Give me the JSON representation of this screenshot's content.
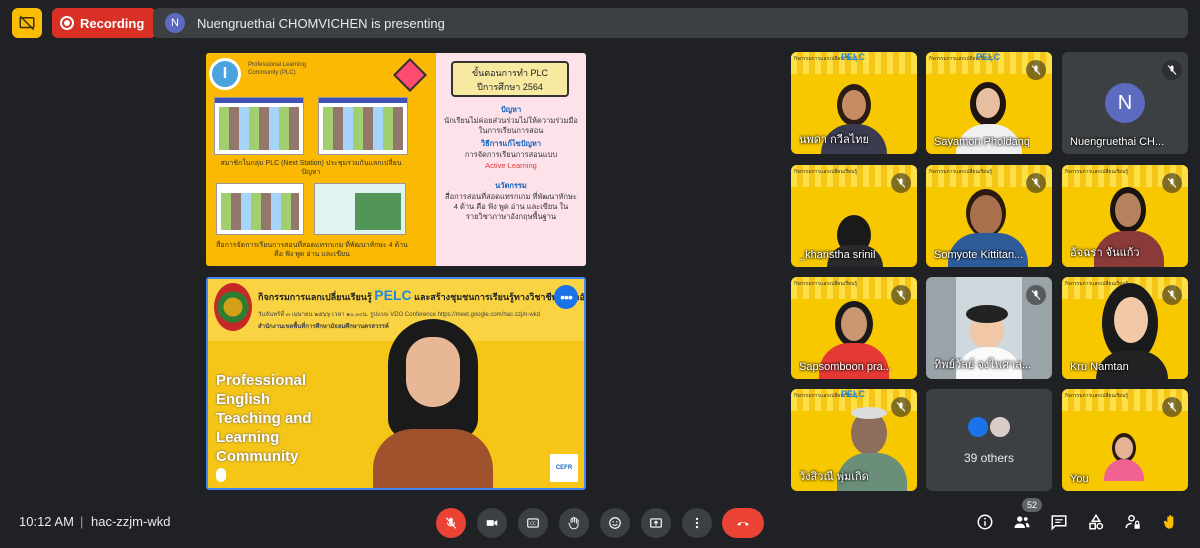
{
  "topbar": {
    "recording_label": "Recording",
    "presenter_initial": "N",
    "presenting_text": "Nuengruethai CHOMVICHEN is presenting"
  },
  "slide1": {
    "logo_letter": "I",
    "plc_label": "Professional Learning Community (PLC)",
    "caption_1": "สมาชิกในกลุ่ม PLC (Next Station) ประชุมร่วมกันแลกเปลี่ยนปัญหา",
    "caption_2": "สื่อการจัดการเรียนการสอนที่สอดแทรกเกม ที่พัฒนาทักษะ 4 ด้าน คือ ฟัง พูด อ่าน และเขียน",
    "callout_line1": "ขั้นตอนการทำ PLC",
    "callout_line2": "ปีการศึกษา 2564",
    "problem_head": "ปัญหา",
    "problem_text": "นักเรียนไม่ค่อยส่วนร่วมไม่ให้ความร่วมมือในการเรียนการสอน",
    "solution_head": "วิธีการแก้ไขปัญหา",
    "solution_text": "การจัดการเรียนการสอนแบบ",
    "solution_red": "Active Learning",
    "innov_head": "นวัตกรรม",
    "innov_text": "สื่อการสอนที่สอดแทรกเกม ที่พัฒนาทักษะ 4 ด้าน คือ ฟัง พูด อ่าน และเขียน ในรายวิชาภาษาอังกฤษพื้นฐาน"
  },
  "slide2": {
    "title_prefix": "กิจกรรมการแลกเปลี่ยนเรียนรู้",
    "title_pelc": "PELC",
    "title_suffix": "และสร้างชุมชนการเรียนรู้ทางวิชาชีพภาษาอังกฤษ",
    "line_1": "วันจันทร์ที่ ๓ เมษายน ๒๕๖๖ เวลา ๑๐.๐๐น. รูปแบบ VDO Conference https://meet.google.com/hac-zzjm-wkd",
    "line_2": "สำนักงานเขตพื้นที่การศึกษามัธยมศึกษานครสวรรค์",
    "big_text": "Professional English Teaching and Learning Community",
    "cefr": "CEFR",
    "more_label": "•••"
  },
  "tiles": [
    {
      "name": "นพดา กวีลไทย",
      "muted": false
    },
    {
      "name": "Sayamon Pholdang",
      "muted": true
    },
    {
      "name": "Nuengruethai CH...",
      "muted": true,
      "initial": "N"
    },
    {
      "name": "_kharistha srinil",
      "muted": true
    },
    {
      "name": "Somyote Kittitan...",
      "muted": true
    },
    {
      "name": "อัจฉรา จันแก้ว",
      "muted": true
    },
    {
      "name": "Sapsomboon pra...",
      "muted": true
    },
    {
      "name": "ทิพย์วัลย์ จงไพศาล...",
      "muted": true
    },
    {
      "name": "Kru Namtan",
      "muted": true
    },
    {
      "name": "วังสิวณี พุ่มเกิด",
      "muted": true
    },
    {
      "name": "39 others",
      "muted": false
    },
    {
      "name": "You",
      "muted": true
    }
  ],
  "tile_header": "PELC",
  "tile_band_text": "กิจกรรมการแลกเปลี่ยนเรียนรู้",
  "bottombar": {
    "time": "10:12 AM",
    "separator": "|",
    "meeting_code": "hac-zzjm-wkd",
    "participants_count": "52"
  },
  "colors": {
    "recording": "#d93025",
    "hangup": "#ea4335",
    "presenter_avatar": "#5c6bc0",
    "slide_yellow": "#f7c800"
  }
}
